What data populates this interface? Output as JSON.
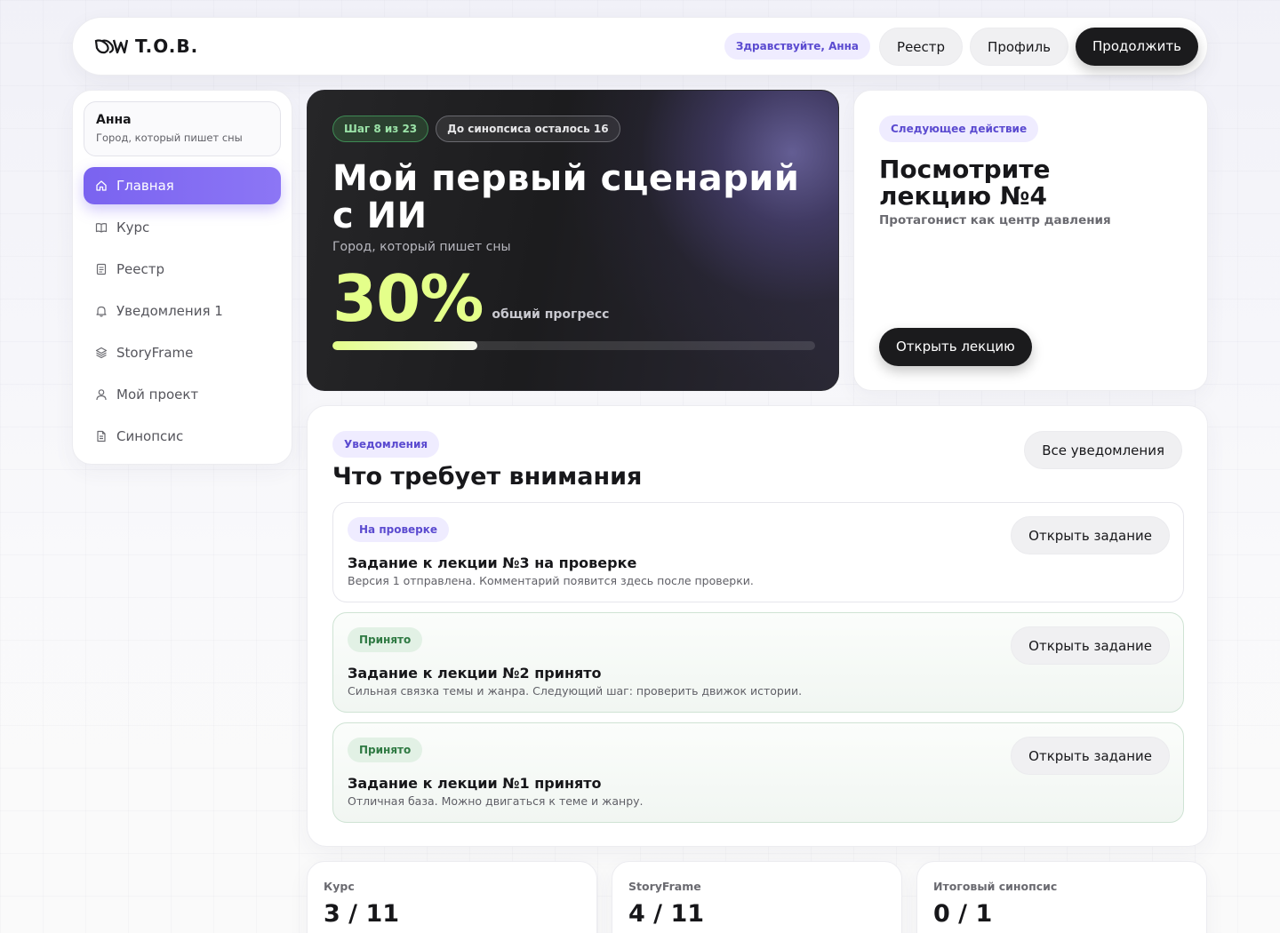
{
  "brand": {
    "name": "T.O.B."
  },
  "header": {
    "greeting": "Здравствуйте, Анна",
    "nav_registry": "Реестр",
    "nav_profile": "Профиль",
    "cta": "Продолжить"
  },
  "sidebar": {
    "user_name": "Анна",
    "project_name": "Город, который пишет сны",
    "items": [
      {
        "label": "Главная",
        "icon": "home-icon",
        "active": true
      },
      {
        "label": "Курс",
        "icon": "book-icon"
      },
      {
        "label": "Реестр",
        "icon": "document-icon"
      },
      {
        "label": "Уведомления 1",
        "icon": "bell-icon"
      },
      {
        "label": "StoryFrame",
        "icon": "layers-icon"
      },
      {
        "label": "Мой проект",
        "icon": "user-icon"
      },
      {
        "label": "Синопсис",
        "icon": "file-text-icon"
      }
    ]
  },
  "hero": {
    "step": "Шаг 8 из 23",
    "remaining": "До синопсиса осталось 16",
    "title": "Мой первый сценарий с ИИ",
    "subtitle": "Город, который пишет сны",
    "percent_text": "30%",
    "percent_label": "общий прогресс",
    "progress": 0.3
  },
  "next_action": {
    "tag": "Следующее действие",
    "title": "Посмотрите лекцию №4",
    "subtitle": "Протагонист как центр давления",
    "button": "Открыть лекцию"
  },
  "notifications": {
    "tag": "Уведомления",
    "title": "Что требует внимания",
    "all_button": "Все уведомления",
    "items": [
      {
        "status": "На проверке",
        "status_kind": "review",
        "title": "Задание к лекции №3 на проверке",
        "desc": "Версия 1 отправлена. Комментарий появится здесь после проверки.",
        "button": "Открыть задание"
      },
      {
        "status": "Принято",
        "status_kind": "accepted",
        "title": "Задание к лекции №2 принято",
        "desc": "Сильная связка темы и жанра. Следующий шаг: проверить движок истории.",
        "button": "Открыть задание"
      },
      {
        "status": "Принято",
        "status_kind": "accepted",
        "title": "Задание к лекции №1 принято",
        "desc": "Отличная база. Можно двигаться к теме и жанру.",
        "button": "Открыть задание"
      }
    ]
  },
  "stats": [
    {
      "label": "Курс",
      "value": "3 / 11"
    },
    {
      "label": "StoryFrame",
      "value": "4 / 11"
    },
    {
      "label": "Итоговый синопсис",
      "value": "0 / 1"
    }
  ],
  "colors": {
    "accent": "#7a63f0",
    "lime": "#e4ff8a",
    "accepted": "#2f7a43",
    "review": "#5b4bd0"
  }
}
